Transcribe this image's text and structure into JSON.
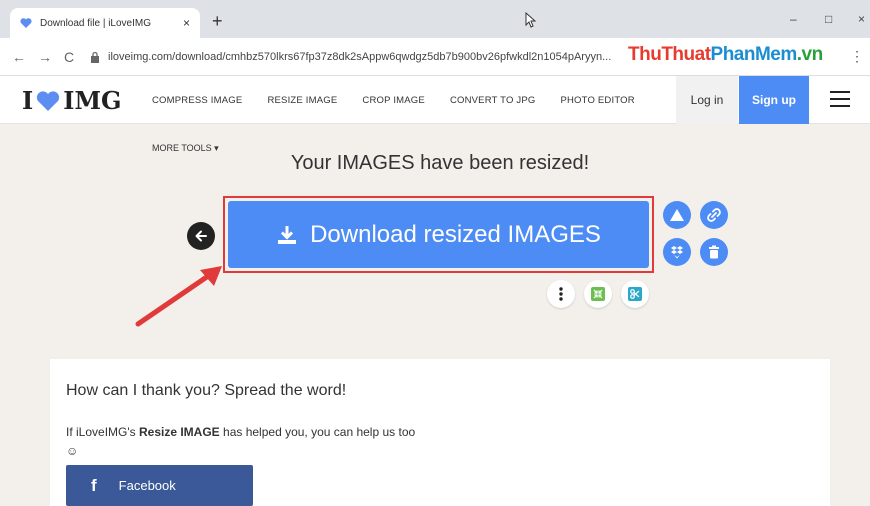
{
  "browser": {
    "tab_title": "Download file | iLoveIMG",
    "tab_close": "×",
    "new_tab": "+",
    "url": "iloveimg.com/download/cmhbz570lkrs67fp37z8dk2sAppw6qwdgz5db7b900bv26pfwkdl2n1054pAryyn...",
    "nav_back": "←",
    "nav_forward": "→",
    "nav_reload": "C",
    "win_minimize": "–",
    "win_maximize": "□",
    "win_close": "×",
    "menu": "⋮"
  },
  "watermark": {
    "part1": "ThuThuat",
    "part2": "PhanMem",
    "part3": ".vn"
  },
  "header": {
    "logo_left": "I",
    "logo_right": "IMG",
    "nav": [
      "COMPRESS IMAGE",
      "RESIZE IMAGE",
      "CROP IMAGE",
      "CONVERT TO JPG",
      "PHOTO EDITOR"
    ],
    "login": "Log in",
    "signup": "Sign up"
  },
  "main": {
    "more_tools": "MORE TOOLS ▾",
    "title": "Your IMAGES have been resized!",
    "download_label": "Download resized IMAGES"
  },
  "share": {
    "title": "How can I thank you? Spread the word!",
    "text_before": "If iLoveIMG's ",
    "text_bold": "Resize IMAGE",
    "text_after": " has helped you, you can help us too ☺",
    "facebook": "Facebook"
  },
  "colors": {
    "accent": "#4d8cf5",
    "highlight": "#e13a3a",
    "facebook": "#3b5998",
    "page_bg": "#f3f0ec"
  }
}
